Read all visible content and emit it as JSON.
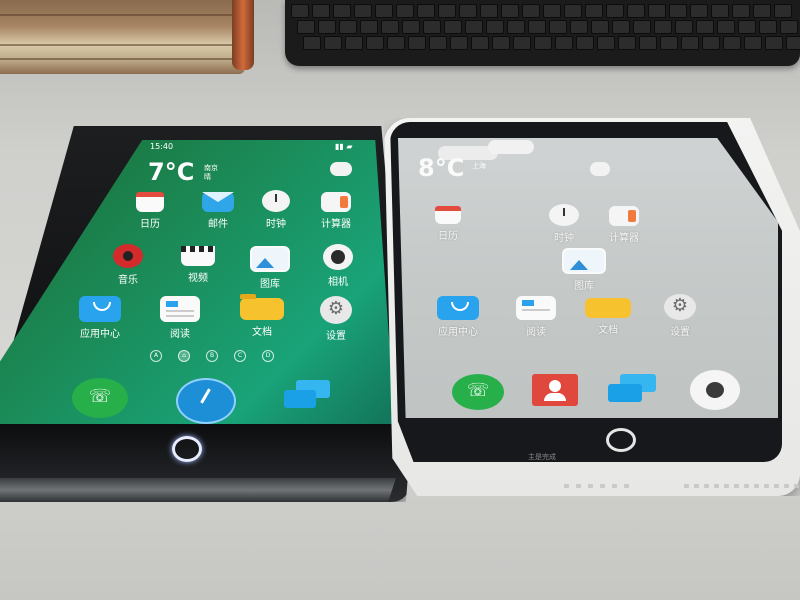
{
  "left_phone": {
    "status_time": "15:40",
    "weather": {
      "temp": "7°C",
      "city_line1": "南京",
      "city_line2": "晴"
    },
    "apps": [
      {
        "label": "日历",
        "icon": "calendar-icon"
      },
      {
        "label": "邮件",
        "icon": "mail-icon"
      },
      {
        "label": "时钟",
        "icon": "clock-icon"
      },
      {
        "label": "计算器",
        "icon": "calculator-icon"
      },
      {
        "label": "音乐",
        "icon": "music-icon"
      },
      {
        "label": "视频",
        "icon": "video-icon"
      },
      {
        "label": "图库",
        "icon": "gallery-icon"
      },
      {
        "label": "相机",
        "icon": "camera-icon"
      },
      {
        "label": "应用中心",
        "icon": "app-center-icon"
      },
      {
        "label": "阅读",
        "icon": "reader-icon"
      },
      {
        "label": "文档",
        "icon": "documents-icon"
      },
      {
        "label": "设置",
        "icon": "settings-icon"
      }
    ],
    "page_indicators": [
      "A",
      "⌂",
      "B",
      "C",
      "D"
    ],
    "dock": [
      "phone-icon",
      "browser-icon",
      "messages-icon"
    ],
    "colors": {
      "screen": "#1b8a57",
      "bezel": "#111214",
      "home_ring": "#ffffff"
    }
  },
  "right_phone": {
    "status_time": "",
    "weather": {
      "temp": "8°C",
      "city_line1": "上海",
      "city_line2": ""
    },
    "apps": [
      {
        "label": "日历",
        "icon": "calendar-icon"
      },
      {
        "label": "时钟",
        "icon": "clock-icon"
      },
      {
        "label": "计算器",
        "icon": "calculator-icon"
      },
      {
        "label": "图库",
        "icon": "gallery-icon"
      },
      {
        "label": "应用中心",
        "icon": "app-center-icon"
      },
      {
        "label": "阅读",
        "icon": "reader-icon"
      },
      {
        "label": "文档",
        "icon": "documents-icon"
      },
      {
        "label": "设置",
        "icon": "settings-icon"
      }
    ],
    "dock": [
      "phone-icon",
      "contacts-icon",
      "messages-icon",
      "camera-icon"
    ],
    "bottom_text": "主是完成",
    "colors": {
      "screen": "#c5c9c8",
      "body": "#f3f3f2",
      "home_ring": "#e8e8e8"
    }
  }
}
